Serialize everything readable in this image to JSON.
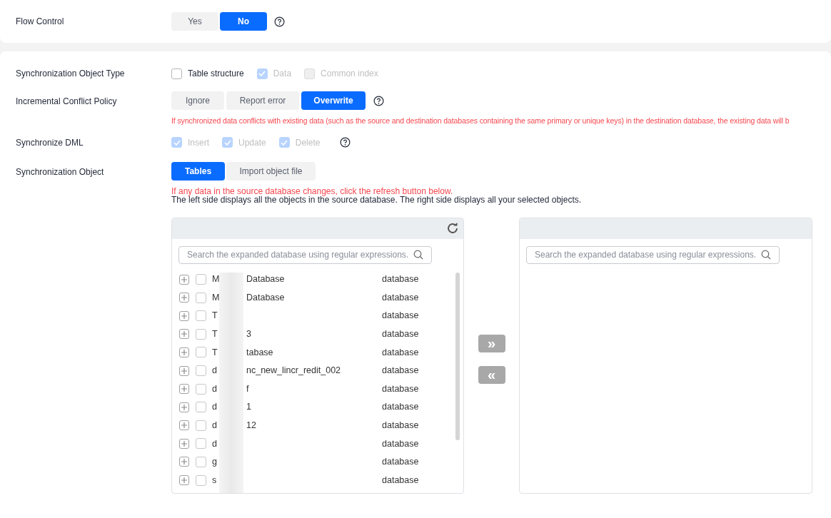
{
  "flow_control": {
    "label": "Flow Control",
    "options": [
      {
        "label": "Yes",
        "selected": false
      },
      {
        "label": "No",
        "selected": true
      }
    ]
  },
  "object_type": {
    "label": "Synchronization Object Type",
    "options": [
      {
        "label": "Table structure",
        "checked": false,
        "disabled": false
      },
      {
        "label": "Data",
        "checked": true,
        "disabled": true
      },
      {
        "label": "Common index",
        "checked": false,
        "disabled": true
      }
    ]
  },
  "conflict_policy": {
    "label": "Incremental Conflict Policy",
    "options": [
      {
        "label": "Ignore",
        "selected": false
      },
      {
        "label": "Report error",
        "selected": false
      },
      {
        "label": "Overwrite",
        "selected": true
      }
    ],
    "warning": "If synchronized data conflicts with existing data (such as the source and destination databases containing the same primary or unique keys) in the destination database, the existing data will b"
  },
  "dml": {
    "label": "Synchronize DML",
    "options": [
      {
        "label": "Insert",
        "checked": true,
        "disabled": true
      },
      {
        "label": "Update",
        "checked": true,
        "disabled": true
      },
      {
        "label": "Delete",
        "checked": true,
        "disabled": true
      }
    ]
  },
  "sync_object": {
    "label": "Synchronization Object",
    "options": [
      {
        "label": "Tables",
        "selected": true
      },
      {
        "label": "Import object file",
        "selected": false
      }
    ],
    "warning": "If any data in the source database changes, click the refresh button below.",
    "note": "The left side displays all the objects in the source database. The right side displays all your selected objects."
  },
  "source_panel": {
    "search": {
      "placeholder": "Search the expanded database using regular expressions."
    },
    "rows": [
      {
        "name_start": "M",
        "name_end": "Database",
        "type": "database",
        "checked": false
      },
      {
        "name_start": "M",
        "name_end": "Database",
        "type": "database",
        "checked": false
      },
      {
        "name_start": "T",
        "type": "database",
        "checked": false
      },
      {
        "name_start": "T",
        "name_end": "3",
        "type": "database",
        "checked": false
      },
      {
        "name_start": "T",
        "name_end": "tabase",
        "type": "database",
        "checked": false
      },
      {
        "name_start": "d",
        "name_end": "nc_new_lincr_redit_002",
        "type": "database",
        "checked": false
      },
      {
        "name_start": "d",
        "name_end": "f",
        "type": "database",
        "checked": false
      },
      {
        "name_start": "d",
        "name_end": "1",
        "type": "database",
        "checked": false
      },
      {
        "name_start": "d",
        "name_end": "12",
        "type": "database",
        "checked": false
      },
      {
        "name_start": "d",
        "type": "database",
        "checked": false
      },
      {
        "name_start": "g",
        "type": "database",
        "checked": false
      },
      {
        "name_start": "s",
        "type": "database",
        "checked": false
      }
    ]
  },
  "transfer": {
    "add": "»",
    "remove": "«"
  },
  "selected_panel": {
    "search": {
      "placeholder": "Search the expanded database using regular expressions."
    }
  }
}
